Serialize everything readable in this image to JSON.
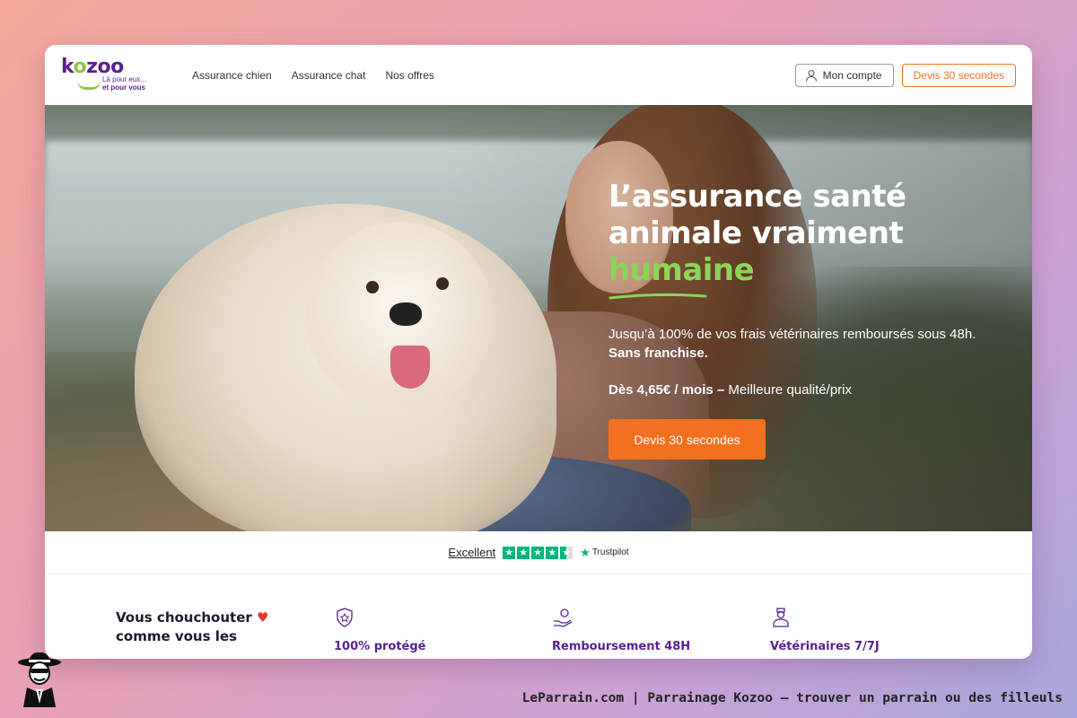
{
  "header": {
    "logo_word_parts": [
      "k",
      "o",
      "z",
      "oo"
    ],
    "logo_tagline_1": "Là pour eux...",
    "logo_tagline_2": "et pour vous",
    "nav": [
      "Assurance chien",
      "Assurance chat",
      "Nos offres"
    ],
    "account_label": "Mon compte",
    "devis_label": "Devis 30 secondes"
  },
  "hero": {
    "title_line1": "L’assurance santé",
    "title_line2": "animale vraiment",
    "title_highlight": "humaine",
    "subtitle_text": "Jusqu’à 100% de vos frais vétérinaires remboursés sous 48h.",
    "subtitle_bold": "Sans franchise.",
    "price_bold": "Dès 4,65€ / mois –",
    "price_rest": "Meilleure qualité/prix",
    "cta_label": "Devis 30 secondes"
  },
  "trustpilot": {
    "rating_label": "Excellent",
    "stars": 4.5,
    "brand": "Trustpilot"
  },
  "features": {
    "intro_line1": "Vous chouchouter",
    "intro_line2": "comme vous les",
    "items": [
      {
        "label": "100% protégé",
        "icon": "shield-star-icon"
      },
      {
        "label": "Remboursement 48H",
        "icon": "hand-coin-icon"
      },
      {
        "label": "Vétérinaires 7/7J",
        "icon": "veterinarian-icon"
      }
    ]
  },
  "caption": "LeParrain.com | Parrainage Kozoo — trouver un parrain ou des filleuls",
  "colors": {
    "brand_purple": "#5b1f8e",
    "brand_green": "#8cc63f",
    "cta_orange": "#f37021",
    "trustpilot_green": "#00b67a"
  }
}
